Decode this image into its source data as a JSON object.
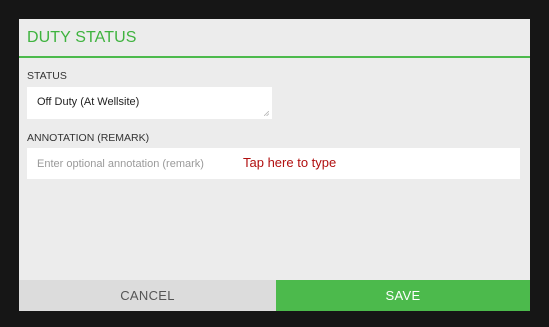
{
  "dialog": {
    "title": "DUTY STATUS",
    "status": {
      "label": "STATUS",
      "value": "Off Duty (At Wellsite)"
    },
    "annotation": {
      "label": "ANNOTATION (REMARK)",
      "value": "",
      "placeholder": "Enter optional annotation (remark)",
      "hint": "Tap here to type"
    },
    "buttons": {
      "cancel": "CANCEL",
      "save": "SAVE"
    }
  },
  "colors": {
    "accent": "#4cba4c",
    "hint": "#b10f0f",
    "dialog_bg": "#ececec"
  },
  "icons": {
    "status_grip": "resize-grip-icon"
  }
}
